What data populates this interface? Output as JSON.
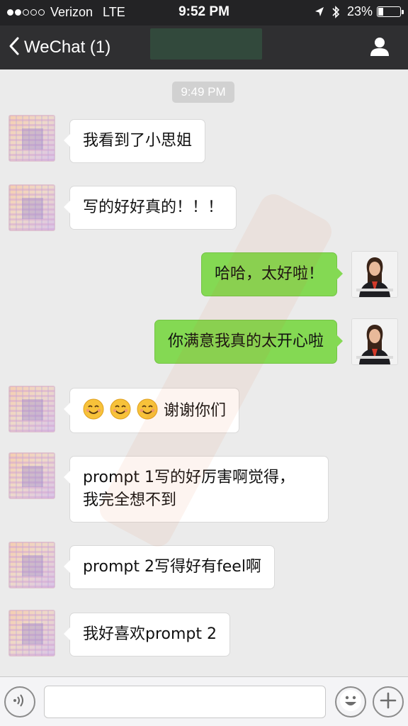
{
  "status_bar": {
    "carrier": "Verizon",
    "network": "LTE",
    "time": "9:52 PM",
    "battery": "23%",
    "battery_level": 0.23,
    "signal_bars_filled": 2,
    "signal_bars_total": 5
  },
  "nav": {
    "back_label": "WeChat (1)",
    "title_block_color": "#355e45"
  },
  "chat": {
    "timestamp": "9:49 PM",
    "messages": [
      {
        "sender": "friend",
        "lines": [
          "我看到了小思姐"
        ]
      },
      {
        "sender": "friend",
        "lines": [
          "写的好好真的！！！"
        ]
      },
      {
        "sender": "self",
        "lines": [
          "哈哈，太好啦！"
        ]
      },
      {
        "sender": "self",
        "lines": [
          "你满意我真的太开心啦"
        ]
      },
      {
        "sender": "friend",
        "emoji_count": 3,
        "emoji": "smiling-face-icon",
        "lines": [
          "谢谢你们"
        ]
      },
      {
        "sender": "friend",
        "lines": [
          "prompt 1写的好厉害啊觉得，",
          "我完全想不到"
        ]
      },
      {
        "sender": "friend",
        "lines": [
          "prompt 2写得好有feel啊"
        ]
      },
      {
        "sender": "friend",
        "lines": [
          "我好喜欢prompt 2"
        ]
      }
    ]
  },
  "input_bar": {
    "voice_icon": "voice-icon",
    "emoji_icon": "emoji-icon",
    "plus_icon": "plus-icon",
    "input_value": ""
  },
  "colors": {
    "chat_background": "#ebebeb",
    "outgoing_bubble": "#84d953",
    "incoming_bubble": "#ffffff",
    "nav_background": "#2f2f31",
    "status_background": "#232325"
  }
}
